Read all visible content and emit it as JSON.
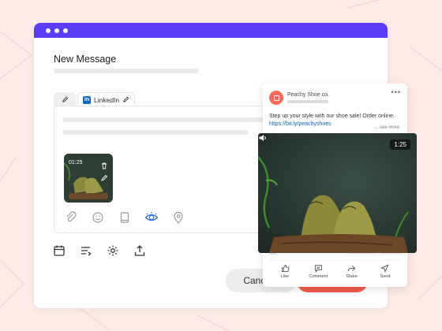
{
  "compose": {
    "title": "New Message",
    "tabs": [
      {
        "name": "edit"
      },
      {
        "label": "LinkedIn"
      }
    ],
    "media": {
      "duration": "01:25"
    },
    "cancel_label": "Cancel"
  },
  "preview": {
    "page_name": "Peachy Shoe co.",
    "post_text": "Step up your style with our shoe sale! Order online:",
    "post_link": "https://bit.ly/peachyshoes",
    "see_more": "... see more",
    "video_duration": "1:25",
    "actions": [
      {
        "label": "Like"
      },
      {
        "label": "Comment"
      },
      {
        "label": "Share"
      },
      {
        "label": "Send"
      }
    ]
  },
  "colors": {
    "window_bar": "#5b3df5",
    "primary": "#f25c4c",
    "linkedin": "#0a66c2",
    "accent_icon": "#2b6de0"
  }
}
